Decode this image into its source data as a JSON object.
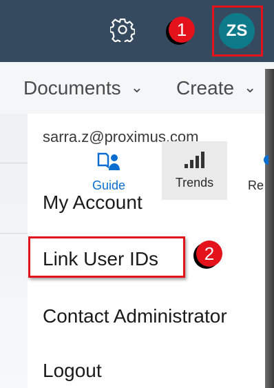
{
  "header": {
    "settings_icon": "gear-icon",
    "avatar_initials": "ZS",
    "colors": {
      "bar": "#354a5f",
      "avatar": "#0e7b8b",
      "highlight": "#e3121b"
    }
  },
  "annotations": {
    "step1": "1",
    "step2": "2"
  },
  "nav": {
    "documents_label": "Documents",
    "create_label": "Create",
    "chevron_icon": "chevron-down-icon"
  },
  "user_menu": {
    "email": "sarra.z@proximus.com",
    "quick_actions": [
      {
        "label": "Guide",
        "icon": "guide-book-icon"
      },
      {
        "label": "Trends",
        "icon": "bar-chart-icon"
      },
      {
        "label": "Re",
        "icon": "reports-icon"
      }
    ],
    "items": [
      {
        "label": "My Account"
      },
      {
        "label": "Link User IDs"
      },
      {
        "label": "Contact Administrator"
      },
      {
        "label": "Logout"
      }
    ]
  }
}
